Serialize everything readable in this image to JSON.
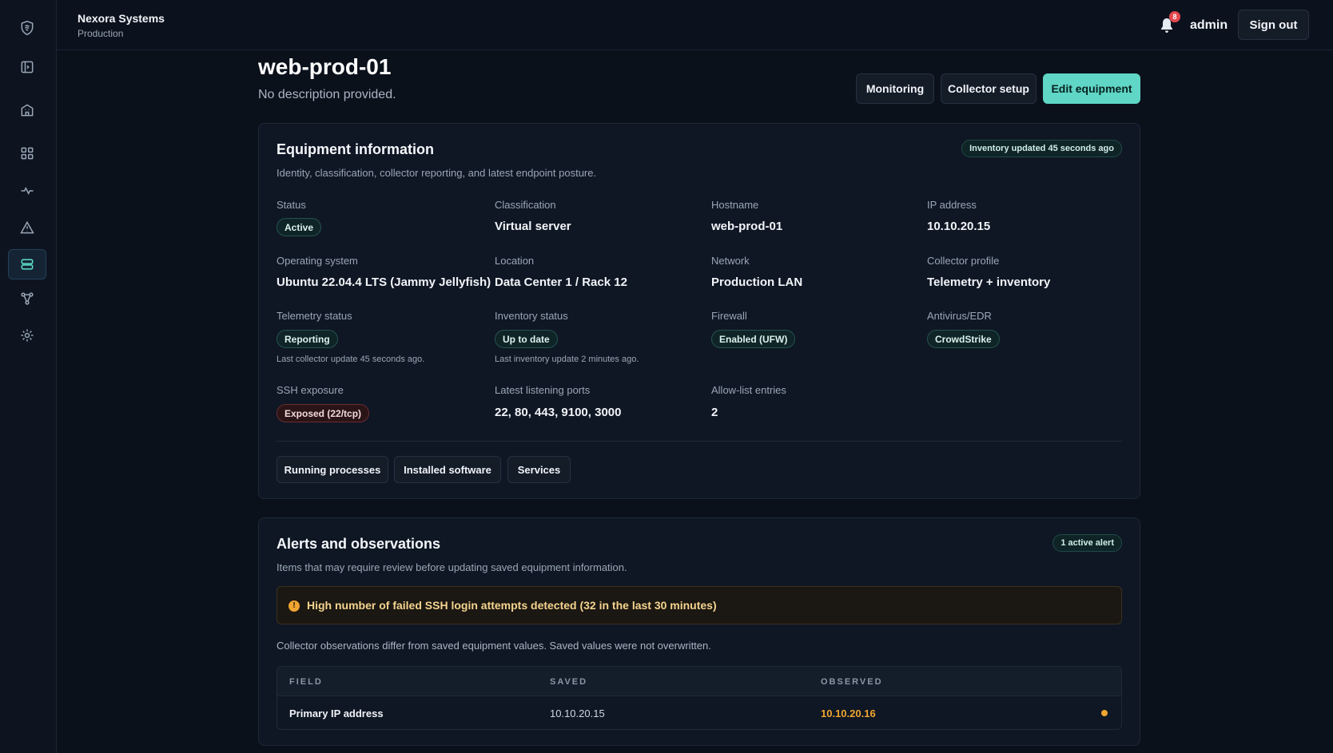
{
  "org": {
    "name": "Nexora Systems",
    "environment": "Production"
  },
  "topbar": {
    "notification_count": "8",
    "user": "admin",
    "signout_label": "Sign out"
  },
  "sidebar": {
    "items": [
      {
        "icon": "shield-logo-icon"
      },
      {
        "icon": "sidebar-toggle-icon"
      },
      {
        "icon": "building-icon"
      },
      {
        "icon": "grid-icon"
      },
      {
        "icon": "activity-icon"
      },
      {
        "icon": "alert-triangle-icon"
      },
      {
        "icon": "server-icon",
        "active": true
      },
      {
        "icon": "network-icon"
      },
      {
        "icon": "gear-icon"
      }
    ]
  },
  "header": {
    "title": "web-prod-01",
    "description": "No description provided.",
    "buttons": {
      "monitoring": "Monitoring",
      "collector_setup": "Collector setup",
      "edit": "Edit equipment"
    }
  },
  "equipment": {
    "title": "Equipment information",
    "subtitle": "Identity, classification, collector reporting, and latest endpoint posture.",
    "updated_pill": "Inventory updated 45 seconds ago",
    "fields": {
      "status": {
        "label": "Status",
        "value": "Active"
      },
      "classification": {
        "label": "Classification",
        "value": "Virtual server"
      },
      "hostname": {
        "label": "Hostname",
        "value": "web-prod-01"
      },
      "ip": {
        "label": "IP address",
        "value": "10.10.20.15"
      },
      "os": {
        "label": "Operating system",
        "value": "Ubuntu 22.04.4 LTS (Jammy Jellyfish)"
      },
      "location": {
        "label": "Location",
        "value": "Data Center 1 / Rack 12"
      },
      "network": {
        "label": "Network",
        "value": "Production LAN"
      },
      "collector_profile": {
        "label": "Collector profile",
        "value": "Telemetry + inventory"
      },
      "telemetry": {
        "label": "Telemetry status",
        "value": "Reporting",
        "note": "Last collector update 45 seconds ago."
      },
      "inventory": {
        "label": "Inventory status",
        "value": "Up to date",
        "note": "Last inventory update 2 minutes ago."
      },
      "firewall": {
        "label": "Firewall",
        "value": "Enabled (UFW)"
      },
      "antivirus": {
        "label": "Antivirus/EDR",
        "value": "CrowdStrike"
      },
      "ssh": {
        "label": "SSH exposure",
        "value": "Exposed (22/tcp)"
      },
      "ports": {
        "label": "Latest listening ports",
        "value": "22, 80, 443, 9100, 3000"
      },
      "allowlist": {
        "label": "Allow-list entries",
        "value": "2"
      }
    },
    "tabs": {
      "processes": "Running processes",
      "software": "Installed software",
      "services": "Services"
    }
  },
  "alerts": {
    "title": "Alerts and observations",
    "subtitle": "Items that may require review before updating saved equipment information.",
    "count_pill": "1 active alert",
    "alert_icon": "!",
    "alert_text": "High number of failed SSH login attempts detected (32 in the last 30 minutes)",
    "diff_note": "Collector observations differ from saved equipment values. Saved values were not overwritten.",
    "table": {
      "headers": {
        "field": "FIELD",
        "saved": "SAVED",
        "observed": "OBSERVED"
      },
      "rows": [
        {
          "field": "Primary IP address",
          "saved": "10.10.20.15",
          "observed": "10.10.20.16"
        }
      ]
    }
  },
  "colors": {
    "accent": "#5fd6c6",
    "warning": "#f0a531",
    "danger": "#e5484d"
  }
}
